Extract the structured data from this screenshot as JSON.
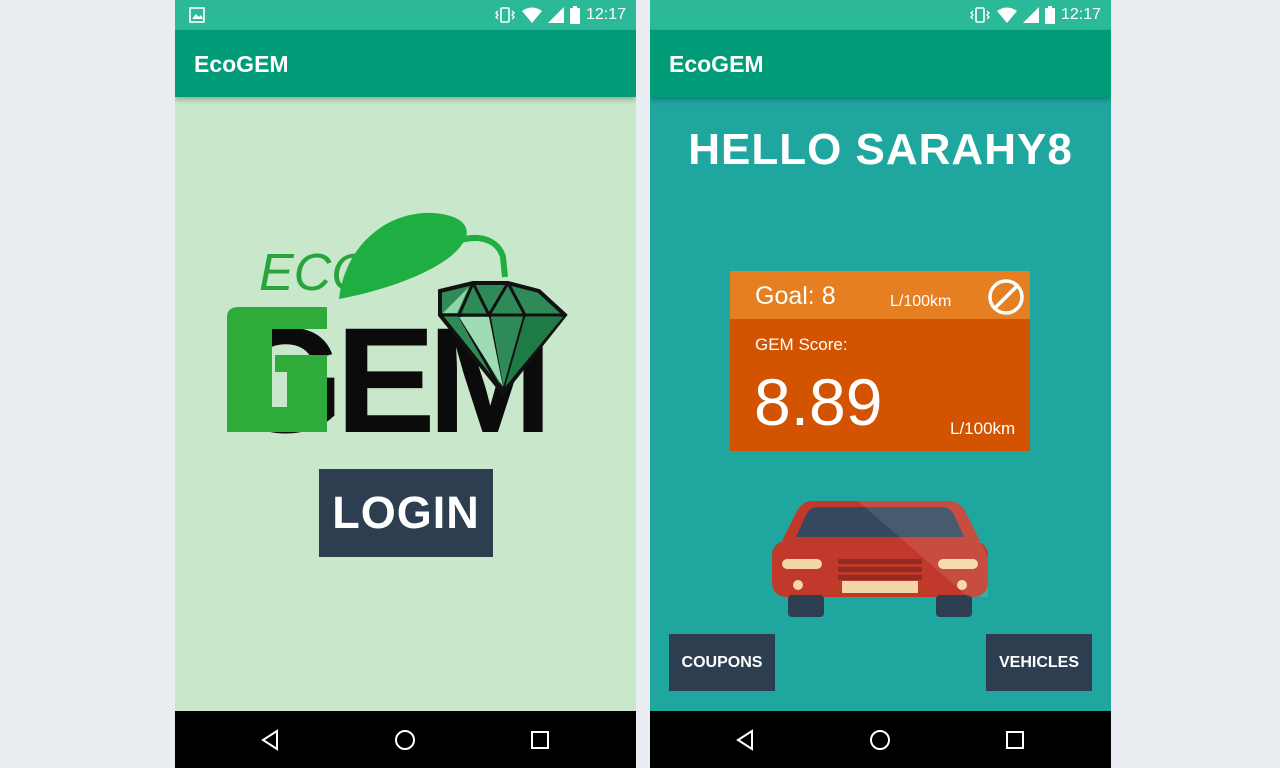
{
  "left_screen": {
    "status": {
      "time": "12:17"
    },
    "app_bar": {
      "title": "EcoGEM"
    },
    "logo": {
      "eco_text": "ECO",
      "gem_text": "GEM"
    },
    "login_label": "LOGIN"
  },
  "right_screen": {
    "status": {
      "time": "12:17"
    },
    "app_bar": {
      "title": "EcoGEM"
    },
    "greeting": "HELLO SARAHY8",
    "goal": {
      "label": "Goal: 8",
      "unit": "L/100km"
    },
    "gem_score": {
      "label": "GEM Score:",
      "value": "8.89",
      "unit": "L/100km"
    },
    "buttons": {
      "coupons": "COUPONS",
      "vehicles": "VEHICLES"
    }
  },
  "colors": {
    "status_bar": "#2bb998",
    "app_bar": "#009b77",
    "login_background": "#c9e7cb",
    "dashboard_background": "#1fa69f",
    "goal_strip": "#e67e22",
    "score_card": "#d35400",
    "button": "#2d3e50"
  },
  "icons": {
    "status_left": "image-icon",
    "vibrate": "vibrate-icon",
    "wifi": "wifi-icon",
    "signal": "signal-icon",
    "battery": "battery-icon",
    "goal_action": "cancel-icon",
    "nav": [
      "back-icon",
      "home-icon",
      "recents-icon"
    ]
  }
}
